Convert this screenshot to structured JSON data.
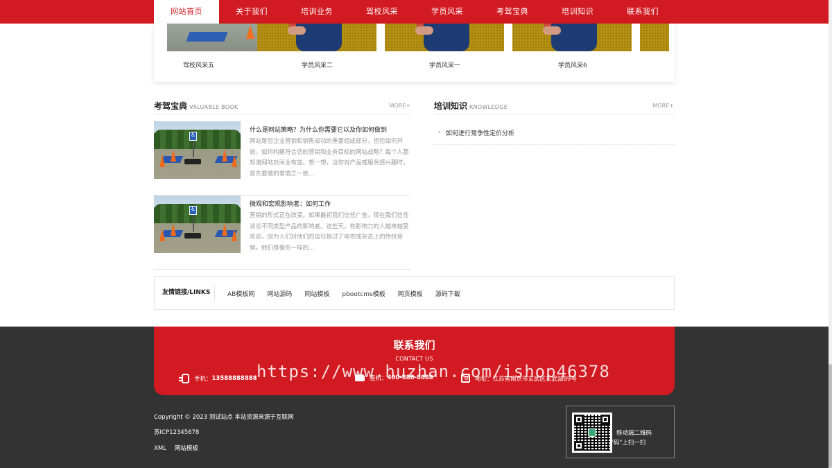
{
  "nav": {
    "items": [
      {
        "label": "网站首页",
        "active": true
      },
      {
        "label": "关于我们"
      },
      {
        "label": "培训业务"
      },
      {
        "label": "驾校风采"
      },
      {
        "label": "学员风采"
      },
      {
        "label": "考驾宝典"
      },
      {
        "label": "培训知识"
      },
      {
        "label": "联系我们"
      }
    ]
  },
  "gallery": {
    "captions": [
      "驾校风采五",
      "学员风采二",
      "学员风采一",
      "学员风采6"
    ]
  },
  "book": {
    "title": "考驾宝典",
    "subtitle": "VALUABLE BOOK",
    "more": "MORE+",
    "items": [
      {
        "title": "什么是网站策略？为什么你需要它以及你如何做到",
        "desc": "网站是您企业营销和销售成功的重要组成部分，但您如何开始，如何构建符合您的营销和业务目标的网站战略？每个人都知道网站对商业有益。想一想，当你对产品或服务感兴趣时，首先要做的事情之一就…"
      },
      {
        "title": "微观和宏观影响者：如何工作",
        "desc": "营销的形式正在改变。如果最初我们信任广告，现在我们信任谈论不同类型产品的影响者。这些天，有影响力的人越来越受欢迎，因为人们对他们的信任超过了电视或杂志上的传统营销。他们是像你一样的…"
      }
    ]
  },
  "knowledge": {
    "title": "培训知识",
    "subtitle": "KNOWLEDGE",
    "more": "MORE+",
    "items": [
      "如何进行竞争性定价分析"
    ]
  },
  "links": {
    "title": "友情链接/LINKS",
    "items": [
      "AB模板网",
      "网站源码",
      "网站模板",
      "pbootcms模板",
      "网页模板",
      "源码下载"
    ]
  },
  "contact": {
    "title": "联系我们",
    "subtitle": "CONTACT US",
    "phone_label": "手机：",
    "phone": "13588888888",
    "tel_label": "座机：",
    "tel": "400-888-8888",
    "addr_label": "地址：",
    "addr": "江苏省南京市玄武区玄武湖89号"
  },
  "watermark": "https://www.huzhan.com/ishop46378",
  "footer": {
    "copyright": "Copyright © 2023 测试站点 本站资源来源于互联网",
    "icp": "苏ICP12345678",
    "links": [
      "XML",
      "网站模板"
    ],
    "qr_line1": "移动端二维码",
    "qr_line2": "\"码\"上扫一扫"
  },
  "colors": {
    "brand_red": "#d11a21",
    "footer_bg": "#333333"
  }
}
